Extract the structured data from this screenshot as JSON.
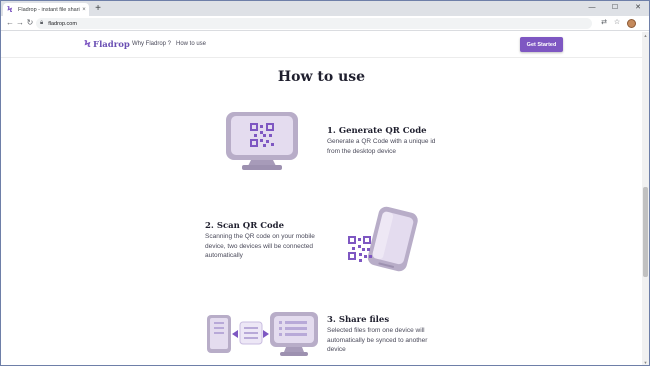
{
  "browser": {
    "tab_title": "Fladrop - instant file sharing",
    "tab_favicon": "Ϟ",
    "tab_close": "×",
    "new_tab": "+",
    "url": "fladrop.com",
    "controls": {
      "minimize": "—",
      "maximize": "☐",
      "close": "✕"
    },
    "nav": {
      "back": "←",
      "forward": "→",
      "reload": "↻"
    }
  },
  "site": {
    "logo_mark": "Ϟ",
    "logo_text": "Fladrop",
    "nav": {
      "why": "Why Fladrop ?",
      "how": "How to use"
    },
    "cta": "Get Started"
  },
  "section": {
    "title": "How to use",
    "steps": [
      {
        "title": "1. Generate QR Code",
        "description": "Generate a QR Code with a unique id from the desktop device",
        "icon": "monitor-qr-icon"
      },
      {
        "title": "2. Scan QR Code",
        "description": "Scanning the QR code on your mobile device, two devices will be connected automatically",
        "icon": "phone-qr-icon"
      },
      {
        "title": "3. Share files",
        "description": "Selected files from one device will automatically be synced to another device",
        "icon": "sync-devices-icon"
      }
    ]
  },
  "colors": {
    "brand": "#7e57c2",
    "device_body": "#b8adc8",
    "device_screen": "#e4dcef",
    "text_dark": "#1f1f2e"
  }
}
